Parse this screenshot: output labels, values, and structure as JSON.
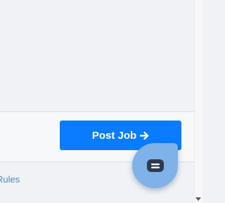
{
  "action_bar": {
    "post_job_label": "Post Job",
    "post_job_icon": "arrow-right-icon"
  },
  "footer": {
    "rules_link_label": "Rules"
  },
  "chat_widget": {
    "icon": "chat-bubble-icon"
  },
  "colors": {
    "primary_button": "#0a7cff",
    "chat_launcher": "#7eb2e8",
    "link": "#4f86c6",
    "page_background": "#f1f2f5"
  }
}
